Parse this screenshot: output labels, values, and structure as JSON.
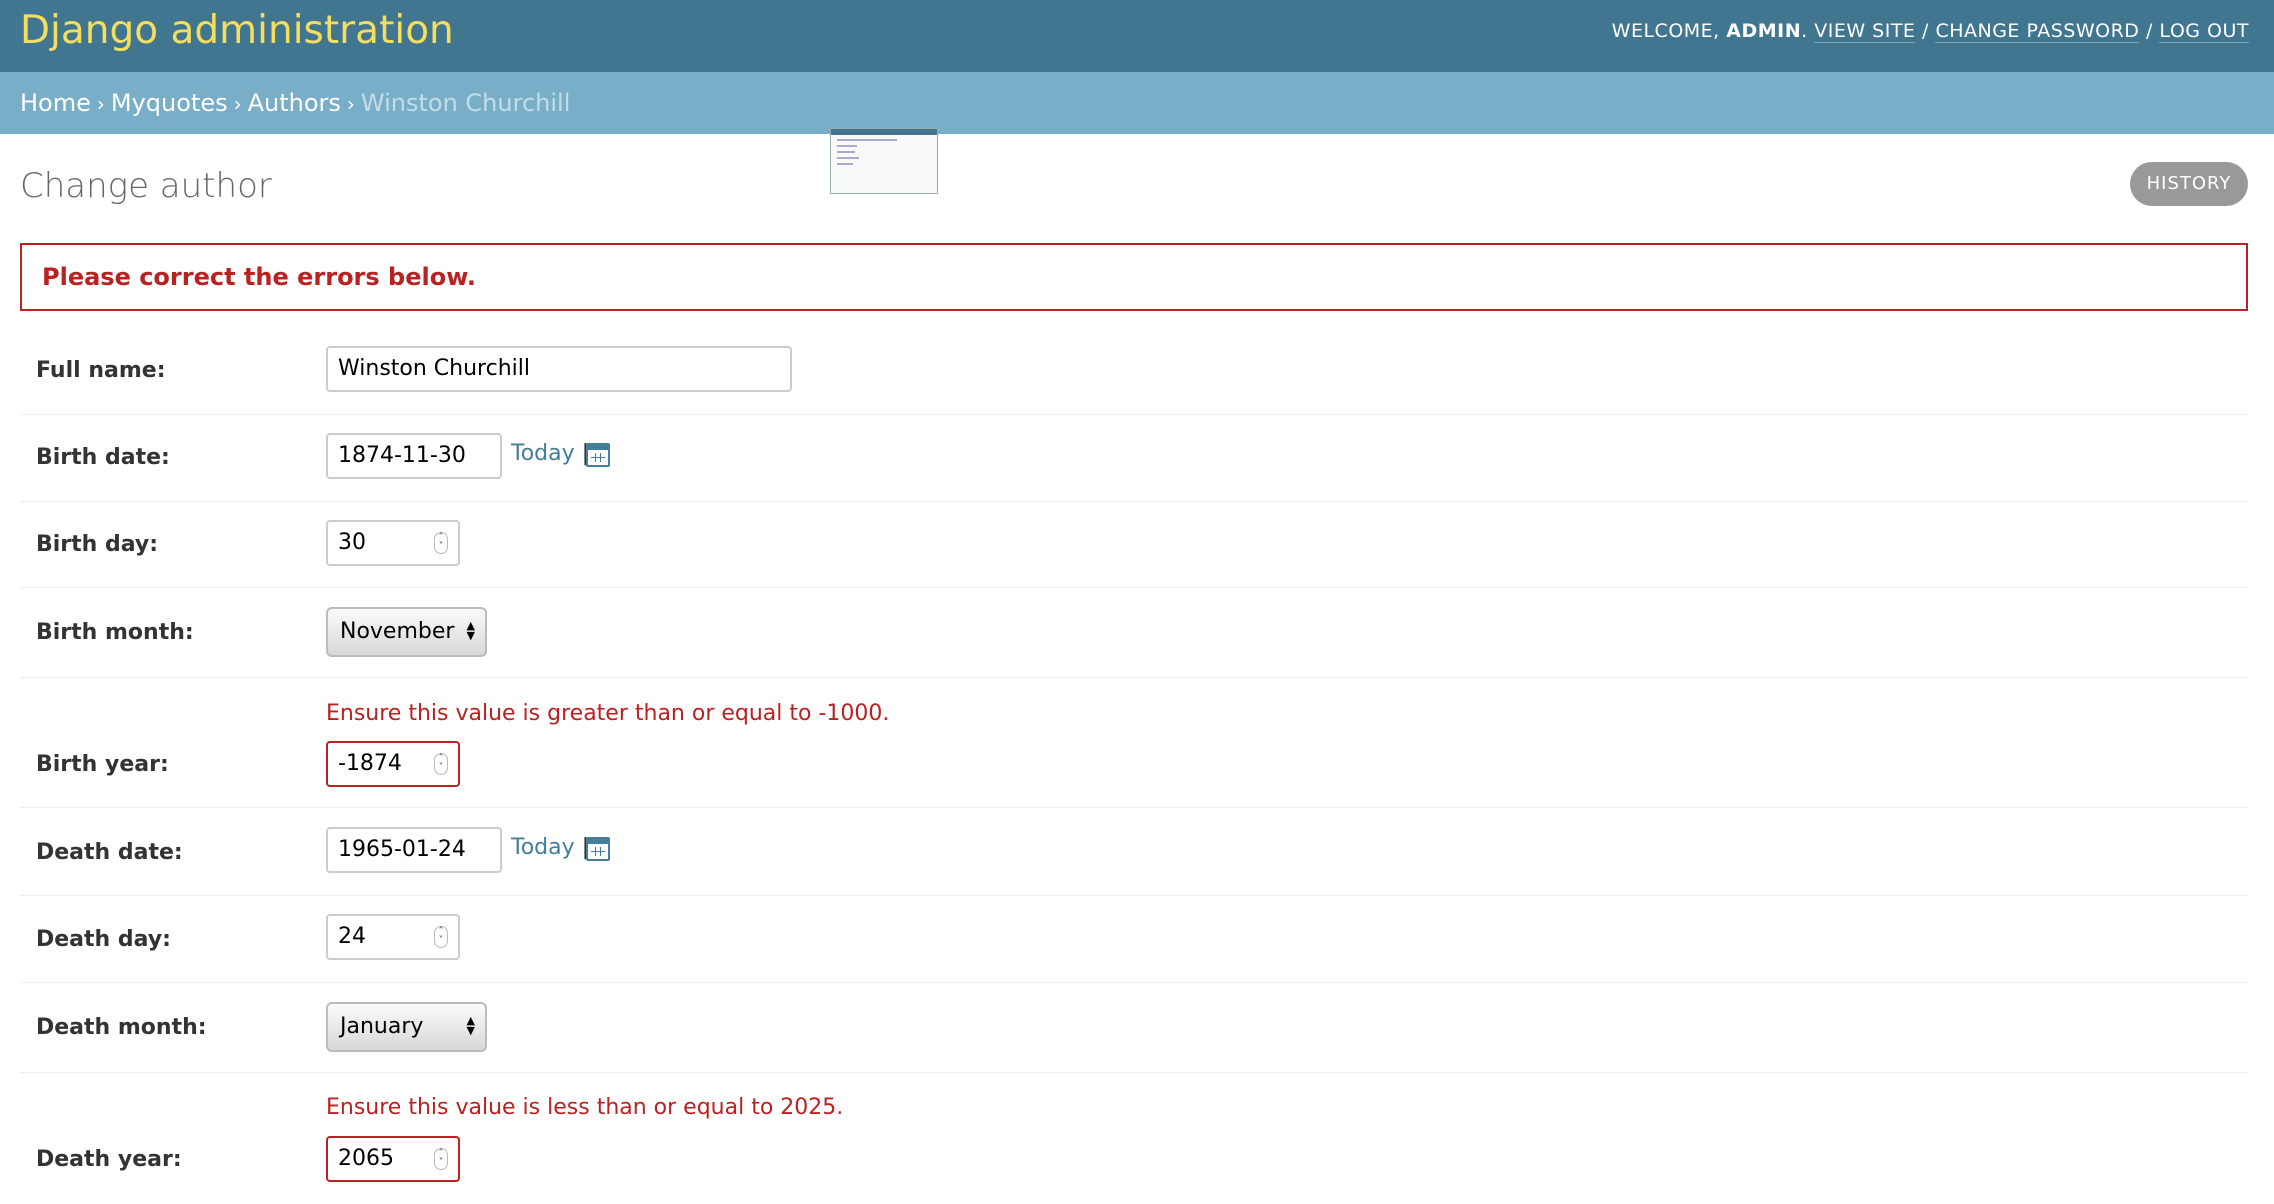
{
  "header": {
    "site_name": "Django administration",
    "welcome": "WELCOME,",
    "user": "ADMIN",
    "view_site": "VIEW SITE",
    "change_password": "CHANGE PASSWORD",
    "log_out": "LOG OUT",
    "separator": "/"
  },
  "breadcrumbs": {
    "home": "Home",
    "app": "Myquotes",
    "model": "Authors",
    "current": "Winston Churchill",
    "separator": "›"
  },
  "page": {
    "title": "Change author",
    "history_label": "HISTORY",
    "error_note": "Please correct the errors below."
  },
  "form": {
    "full_name": {
      "label": "Full name:",
      "value": "Winston Churchill"
    },
    "birth_date": {
      "label": "Birth date:",
      "value": "1874-11-30",
      "today": "Today",
      "pipe": "|"
    },
    "birth_day": {
      "label": "Birth day:",
      "value": "30"
    },
    "birth_month": {
      "label": "Birth month:",
      "value": "November"
    },
    "birth_year": {
      "label": "Birth year:",
      "value": "-1874",
      "error": "Ensure this value is greater than or equal to -1000."
    },
    "death_date": {
      "label": "Death date:",
      "value": "1965-01-24",
      "today": "Today",
      "pipe": "|"
    },
    "death_day": {
      "label": "Death day:",
      "value": "24"
    },
    "death_month": {
      "label": "Death month:",
      "value": "January"
    },
    "death_year": {
      "label": "Death year:",
      "value": "2065",
      "error": "Ensure this value is less than or equal to 2025."
    }
  },
  "colors": {
    "header_bg": "#417690",
    "site_name": "#f5dd5d",
    "breadcrumbs_bg": "#79aec8",
    "error": "#ba2121",
    "link": "#447e9b"
  }
}
